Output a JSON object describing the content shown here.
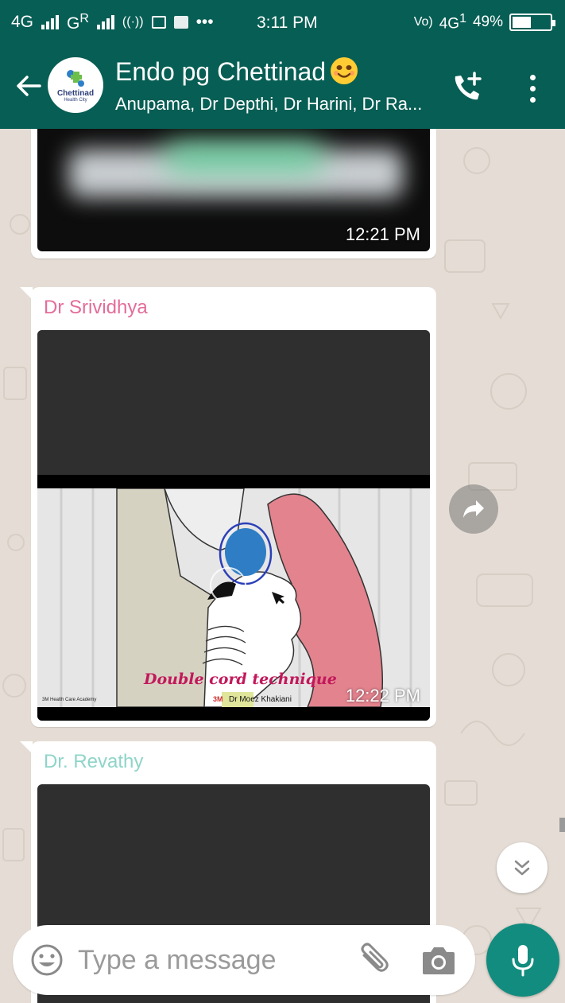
{
  "status_bar": {
    "left_network": "4G",
    "left_roaming": "G",
    "left_roaming_sup": "R",
    "extra": "•••",
    "time": "3:11 PM",
    "volte": "Vo)",
    "net_type": "4G",
    "sim_badge": "1",
    "battery": "49%",
    "battery_level": 0.49
  },
  "header": {
    "avatar_brand": "Chettinad",
    "avatar_sub": "Health City",
    "title": "Endo pg Chettinad",
    "subtitle": "Anupama, Dr Depthi, Dr Harini, Dr Ra...",
    "accent_color": "#075e54"
  },
  "messages": [
    {
      "sender": "",
      "time": "12:21 PM"
    },
    {
      "sender": "Dr Srividhya",
      "sender_color": "#e46c9a",
      "time": "12:22 PM",
      "caption": "Double cord technique",
      "credit_left": "3M Health Care Academy",
      "credit_brand": "3M",
      "credit_right": "Dr Moez Khakiani"
    },
    {
      "sender": "Dr. Revathy",
      "sender_color": "#8fd4c9"
    }
  ],
  "composer": {
    "placeholder": "Type a message",
    "mic_color": "#128c7e"
  }
}
